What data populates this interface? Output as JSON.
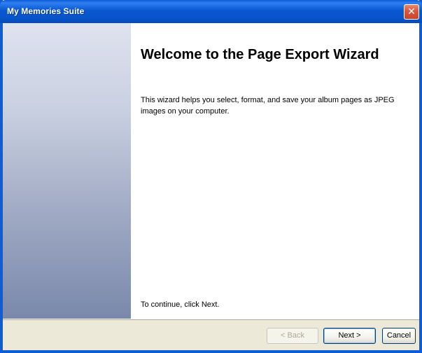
{
  "window": {
    "title": "My Memories Suite",
    "close_glyph": "✕"
  },
  "main": {
    "heading": "Welcome to the Page Export Wizard",
    "description": "This wizard helps you select, format, and save your album pages as JPEG images on your computer.",
    "continue_hint": "To continue, click Next."
  },
  "buttons": {
    "back": "< Back",
    "next": "Next >",
    "cancel": "Cancel"
  },
  "colors": {
    "titlebar": "#0a58d0",
    "close_button": "#d9573c",
    "bottom_bar": "#ece9d8"
  }
}
